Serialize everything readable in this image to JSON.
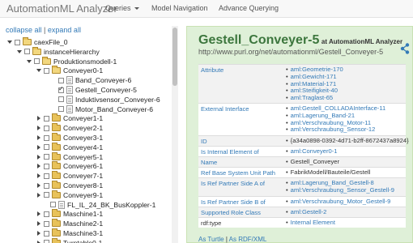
{
  "navbar": {
    "brand": "AutomationML Analyzer",
    "items": [
      {
        "label": "Queries"
      },
      {
        "label": "Model Navigation"
      },
      {
        "label": "Advance Querying"
      }
    ]
  },
  "tree_controls": {
    "collapse": "collapse all",
    "separator": "|",
    "expand": "expand all"
  },
  "tree": [
    {
      "label": "caexFile_0",
      "toggle": "down",
      "icon": "folder-open",
      "checked": false
    },
    {
      "label": "instanceHierarchy",
      "toggle": "down",
      "icon": "folder-open",
      "checked": false
    },
    {
      "label": "Produktionsmodell-1",
      "toggle": "down",
      "icon": "folder-open",
      "checked": false
    },
    {
      "label": "Conveyer0-1",
      "toggle": "down",
      "icon": "folder-open",
      "checked": false
    },
    {
      "label": "Band_Conveyer-6",
      "toggle": "none",
      "icon": "file",
      "checked": false
    },
    {
      "label": "Gestell_Conveyer-5",
      "toggle": "none",
      "icon": "file",
      "checked": true
    },
    {
      "label": "Induktivsensor_Conveyer-6",
      "toggle": "none",
      "icon": "file",
      "checked": false
    },
    {
      "label": "Motor_Band_Conveyer-6",
      "toggle": "none",
      "icon": "file",
      "checked": false
    },
    {
      "label": "Conveyer1-1",
      "toggle": "right",
      "icon": "folder",
      "checked": false
    },
    {
      "label": "Conveyer2-1",
      "toggle": "right",
      "icon": "folder",
      "checked": false
    },
    {
      "label": "Conveyer3-1",
      "toggle": "right",
      "icon": "folder",
      "checked": false
    },
    {
      "label": "Conveyer4-1",
      "toggle": "right",
      "icon": "folder",
      "checked": false
    },
    {
      "label": "Conveyer5-1",
      "toggle": "right",
      "icon": "folder",
      "checked": false
    },
    {
      "label": "Conveyer6-1",
      "toggle": "right",
      "icon": "folder",
      "checked": false
    },
    {
      "label": "Conveyer7-1",
      "toggle": "right",
      "icon": "folder",
      "checked": false
    },
    {
      "label": "Conveyer8-1",
      "toggle": "right",
      "icon": "folder",
      "checked": false
    },
    {
      "label": "Conveyer9-1",
      "toggle": "right",
      "icon": "folder",
      "checked": false
    },
    {
      "label": "FL_IL_24_BK_BusKoppler-1",
      "toggle": "none",
      "icon": "file",
      "checked": false
    },
    {
      "label": "Maschine1-1",
      "toggle": "right",
      "icon": "folder",
      "checked": false
    },
    {
      "label": "Maschine2-1",
      "toggle": "right",
      "icon": "folder",
      "checked": false
    },
    {
      "label": "Maschine3-1",
      "toggle": "right",
      "icon": "folder",
      "checked": false
    },
    {
      "label": "Turntable0-1",
      "toggle": "right",
      "icon": "folder",
      "checked": false
    }
  ],
  "detail": {
    "title": "Gestell_Conveyer-5",
    "subtitle": "at AutomationML Analyzer",
    "uri": "http://www.purl.org/net/automationml/Gestell_Conveyer-5",
    "share_icon": "share-icon",
    "properties": [
      {
        "key_prefix": "",
        "key": "Attribute",
        "values": [
          "aml:Geometrie-170",
          "aml:Gewicht-171",
          "aml:Material-171",
          "aml:Steifigkeit-40",
          "aml:Traglast-65"
        ],
        "value_type": "link-list"
      },
      {
        "key_prefix": "",
        "key": "External Interface",
        "values": [
          "aml:Gestell_COLLADAInterface-11",
          "aml:Lagerung_Band-21",
          "aml:Verschraubung_Motor-11",
          "aml:Verschraubung_Sensor-12"
        ],
        "value_type": "link-list"
      },
      {
        "key_prefix": "",
        "key": "ID",
        "values": [
          "{a34a0898-0392-4d71-b2ff-8672437a8924}"
        ],
        "value_type": "text-bullet"
      },
      {
        "key_prefix": "",
        "key": "Is Internal Element of",
        "values": [
          "aml:Conveyer0-1"
        ],
        "value_type": "link-list"
      },
      {
        "key_prefix": "",
        "key": "Name",
        "values": [
          "Gestell_Conveyer"
        ],
        "value_type": "text-bullet"
      },
      {
        "key_prefix": "",
        "key": "Ref Base System Unit Path",
        "values": [
          "FabrikModell/Bauteile/Gestell"
        ],
        "value_type": "text-bullet"
      },
      {
        "key_prefix": "",
        "key": "Is Ref Partner Side A of",
        "values": [
          "aml:Lagerung_Band_Gestell-8",
          "aml:Verschraubung_Sensor_Gestell-9"
        ],
        "value_type": "link-list"
      },
      {
        "key_prefix": "",
        "key": "Is Ref Partner Side B of",
        "values": [
          "aml:Verschraubung_Motor_Gestell-9"
        ],
        "value_type": "link-list"
      },
      {
        "key_prefix": "",
        "key": "Supported Role Class",
        "values": [
          "aml:Gestell-2"
        ],
        "value_type": "link-list"
      },
      {
        "key_prefix": "rdf:type",
        "key": "",
        "values": [
          "Internal Element"
        ],
        "value_type": "link-list"
      }
    ],
    "footer": {
      "turtle": "As Turtle",
      "separator": "|",
      "rdfxml": "As RDF/XML"
    }
  }
}
